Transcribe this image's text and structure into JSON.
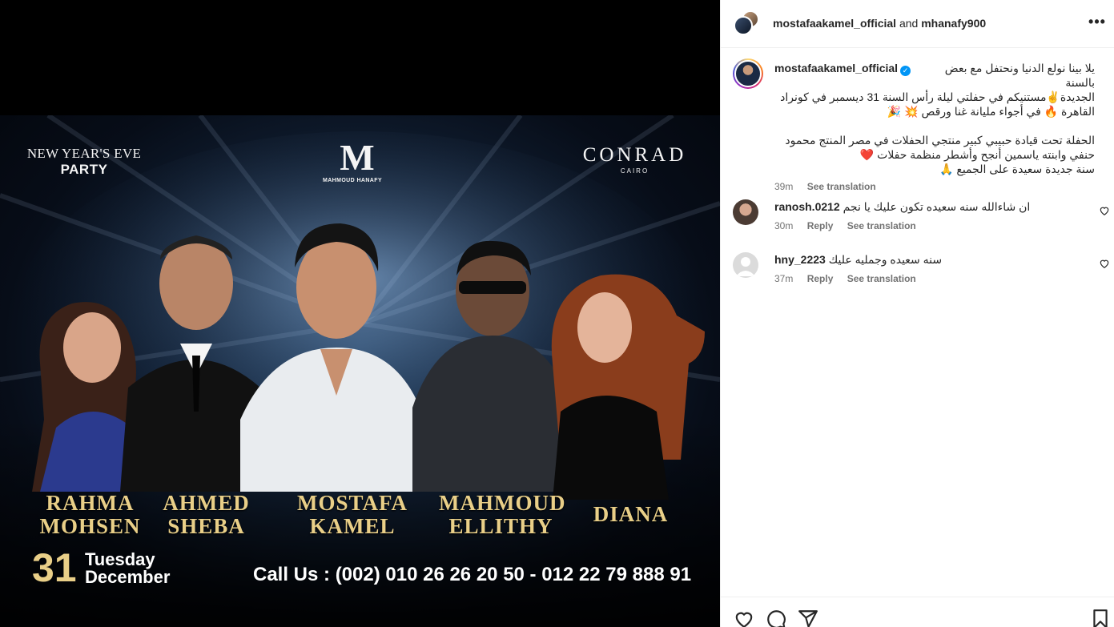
{
  "poster": {
    "nye_line1": "NEW YEAR'S EVE",
    "nye_line2": "PARTY",
    "logo_mark": "M",
    "logo_name": "MAHMOUD HANAFY",
    "venue": "CONRAD",
    "venue_city": "CAIRO",
    "artists": [
      {
        "line1": "RAHMA",
        "line2": "MOHSEN"
      },
      {
        "line1": "AHMED",
        "line2": "SHEBA"
      },
      {
        "line1": "MOSTAFA",
        "line2": "KAMEL"
      },
      {
        "line1": "MAHMOUD",
        "line2": "ELLITHY"
      },
      {
        "line1": "DIANA",
        "line2": ""
      }
    ],
    "date_number": "31",
    "date_day": "Tuesday",
    "date_month": "December",
    "call_us": "Call Us : (002) 010 26 26 20 50 - 012 22 79 888 91"
  },
  "header": {
    "user1": "mostafaakamel_official",
    "conjunction": "and",
    "user2": "mhanafy900",
    "more": "•••"
  },
  "caption": {
    "username": "mostafaakamel_official",
    "verified": "✓",
    "lines": [
      "يلا بينا نولع الدنيا ونحتفل مع بعض بالسنة",
      "الجديدة✌️مستنيكم في حفلتي ليلة رأس السنة 31 ديسمبر في كونراد",
      "القاهرة 🔥 في أجواء مليانة غنا ورقص 💥 🎉",
      "",
      "الحفلة تحت قيادة حبيبي كبير منتجي الحفلات في مصر المنتج محمود",
      "حنفي وابنته ياسمين أنجح وأشطر منظمة حفلات ❤️",
      "سنة جديدة سعيدة على الجميع 🙏"
    ],
    "time": "39m",
    "see_translation": "See translation"
  },
  "comments": [
    {
      "username": "ranosh.0212",
      "text": "ان شاءالله سنه سعيده تكون عليك يا نجم",
      "time": "30m",
      "reply": "Reply",
      "see_translation": "See translation"
    },
    {
      "username": "hny_2223",
      "text": "سنه سعيده وجمليه عليك",
      "time": "37m",
      "reply": "Reply",
      "see_translation": "See translation"
    }
  ],
  "colors": {
    "gold": "#e9cf88",
    "verified": "#0095f6",
    "text": "#262626",
    "muted": "#737373"
  }
}
